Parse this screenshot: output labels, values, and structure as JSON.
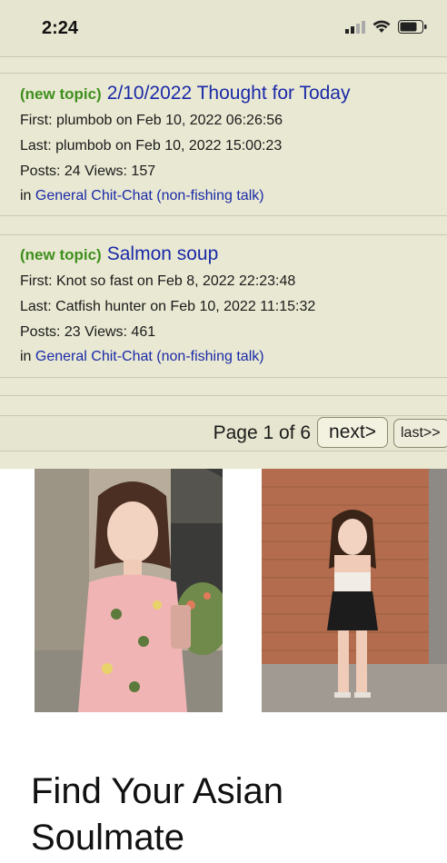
{
  "status": {
    "time": "2:24"
  },
  "topics": [
    {
      "tag": "(new topic)",
      "title": "2/10/2022 Thought for Today",
      "first": "First: plumbob on Feb 10, 2022 06:26:56",
      "last": "Last: plumbob on Feb 10, 2022 15:00:23",
      "stats": "Posts: 24 Views: 157",
      "in_prefix": "in",
      "forum": "General Chit-Chat (non-fishing talk)"
    },
    {
      "tag": "(new topic)",
      "title": "Salmon soup",
      "first": "First: Knot so fast on Feb 8, 2022 22:23:48",
      "last": "Last: Catfish hunter on Feb 10, 2022 11:15:32",
      "stats": "Posts: 23 Views: 461",
      "in_prefix": "in",
      "forum": "General Chit-Chat (non-fishing talk)"
    }
  ],
  "pager": {
    "label": "Page 1 of 6",
    "next": "next>",
    "last": "last>>"
  },
  "ad": {
    "headline": "Find Your Asian Soulmate"
  }
}
